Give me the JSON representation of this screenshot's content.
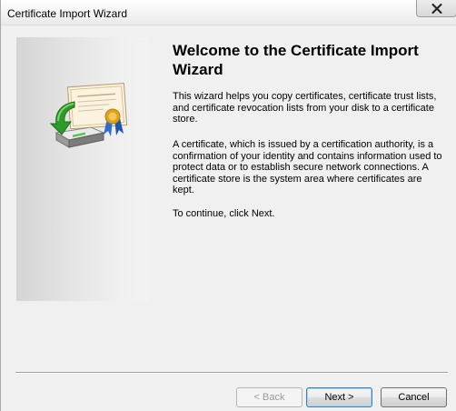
{
  "window": {
    "title": "Certificate Import Wizard",
    "close_icon": "close-icon"
  },
  "main": {
    "heading": "Welcome to the Certificate Import Wizard",
    "paragraph1": "This wizard helps you copy certificates, certificate trust lists, and certificate revocation lists from your disk to a certificate store.",
    "paragraph2": "A certificate, which is issued by a certification authority, is a confirmation of your identity and contains information used to protect data or to establish secure network connections. A certificate store is the system area where certificates are kept.",
    "paragraph3": "To continue, click Next.",
    "wizard_icon": "certificate-import-icon"
  },
  "footer": {
    "back_label": "< Back",
    "next_label": "Next >",
    "cancel_label": "Cancel",
    "back_enabled": false
  },
  "colors": {
    "close_glyph": "#222222",
    "default_button_border": "#3c7fb1",
    "arrow_green": "#2e9a2a",
    "ribbon_blue": "#2d6fd0",
    "seal_gold": "#e0a21c"
  }
}
